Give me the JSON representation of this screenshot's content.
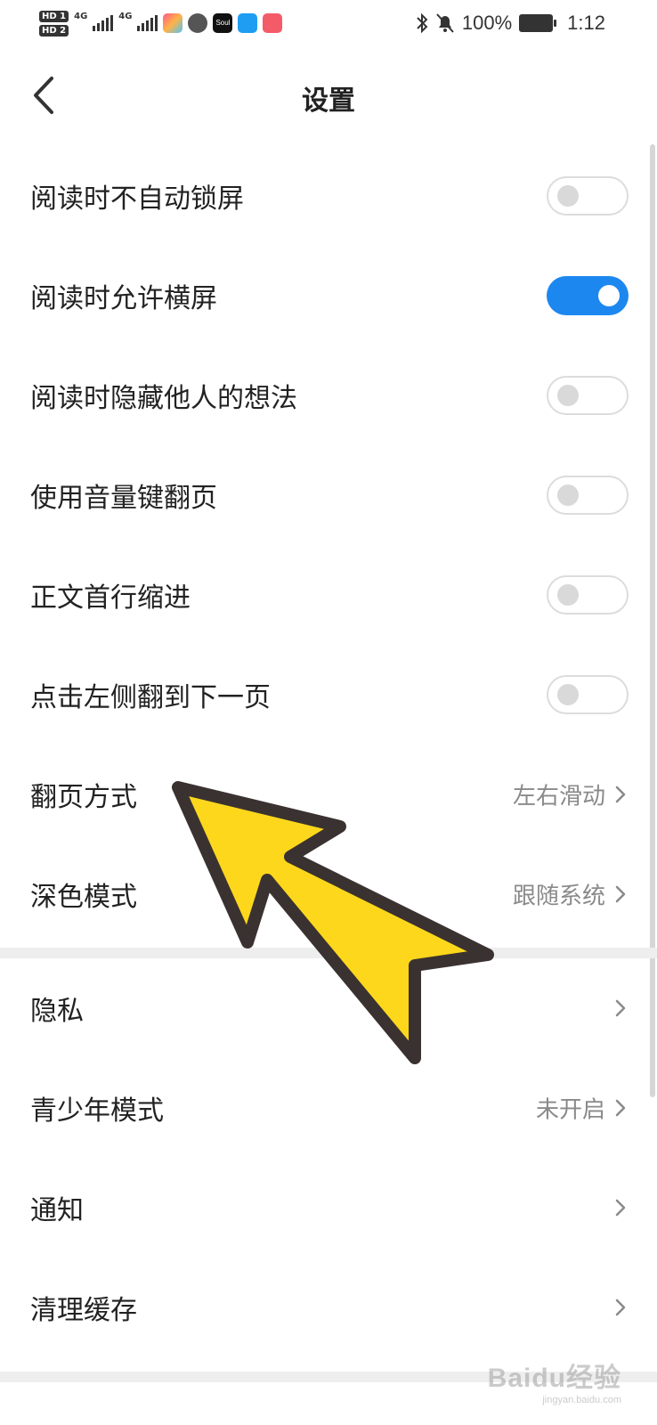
{
  "status_bar": {
    "hd1": "HD 1",
    "hd2": "HD 2",
    "net1": "4G",
    "net2": "4G",
    "soul_icon_text": "Soul",
    "battery": "100%",
    "time": "1:12"
  },
  "header": {
    "title": "设置"
  },
  "toggles": [
    {
      "label": "阅读时不自动锁屏",
      "on": false
    },
    {
      "label": "阅读时允许横屏",
      "on": true
    },
    {
      "label": "阅读时隐藏他人的想法",
      "on": false
    },
    {
      "label": "使用音量键翻页",
      "on": false
    },
    {
      "label": "正文首行缩进",
      "on": false
    },
    {
      "label": "点击左侧翻到下一页",
      "on": false
    }
  ],
  "nav_rows": [
    {
      "label": "翻页方式",
      "value": "左右滑动"
    },
    {
      "label": "深色模式",
      "value": "跟随系统"
    }
  ],
  "nav_rows_2": [
    {
      "label": "隐私",
      "value": ""
    },
    {
      "label": "青少年模式",
      "value": "未开启"
    },
    {
      "label": "通知",
      "value": ""
    },
    {
      "label": "清理缓存",
      "value": ""
    }
  ],
  "watermark": {
    "text": "Baidu经验",
    "sub": "jingyan.baidu.com"
  },
  "colors": {
    "accent": "#1d87f0",
    "arrow_fill": "#fdd71b",
    "arrow_stroke": "#3a3231"
  }
}
